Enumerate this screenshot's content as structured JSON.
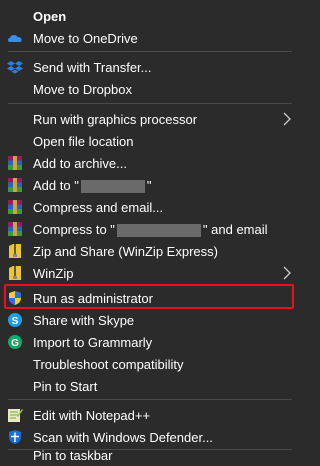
{
  "menu": {
    "items": [
      {
        "label": "Open"
      },
      {
        "label": "Move to OneDrive",
        "icon": "onedrive-icon"
      },
      {
        "label": "Send with Transfer...",
        "icon": "dropbox-icon"
      },
      {
        "label": "Move to Dropbox"
      },
      {
        "label": "Run with graphics processor"
      },
      {
        "label": "Open file location"
      },
      {
        "label": "Add to archive...",
        "icon": "winrar-icon"
      },
      {
        "pre": "Add to \"",
        "post": "\"",
        "icon": "winrar-icon"
      },
      {
        "label": "Compress and email...",
        "icon": "winrar-icon"
      },
      {
        "pre": "Compress to \"",
        "post": "\" and email",
        "icon": "winrar-icon"
      },
      {
        "label": "Zip and Share (WinZip Express)",
        "icon": "winzip-icon"
      },
      {
        "label": "WinZip",
        "icon": "winzip-icon"
      },
      {
        "label": "Run as administrator",
        "icon": "uac-shield-icon"
      },
      {
        "label": "Share with Skype",
        "icon": "skype-icon"
      },
      {
        "label": "Import to Grammarly",
        "icon": "grammarly-icon"
      },
      {
        "label": "Troubleshoot compatibility"
      },
      {
        "label": "Pin to Start"
      },
      {
        "label": "Edit with Notepad++",
        "icon": "notepadpp-icon"
      },
      {
        "label": "Scan with Windows Defender...",
        "icon": "defender-icon"
      },
      {
        "label": "Pin to taskbar"
      }
    ],
    "colors": {
      "background": "#2b2b2b",
      "text": "#ffffff",
      "separator": "#4a4a4a",
      "highlight_border": "#e81123"
    }
  }
}
